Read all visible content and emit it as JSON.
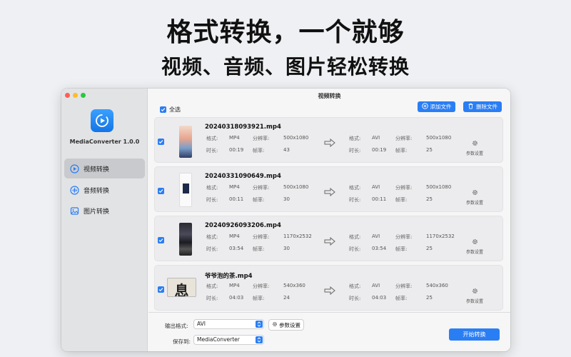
{
  "headline": {
    "line1": "格式转换，一个就够",
    "line2": "视频、音频、图片轻松转换"
  },
  "sidebar": {
    "app_name": "MediaConverter 1.0.0",
    "items": [
      {
        "label": "视频转换",
        "icon": "play-circle-icon",
        "active": true
      },
      {
        "label": "音频转换",
        "icon": "audio-wave-icon",
        "active": false
      },
      {
        "label": "图片转换",
        "icon": "image-icon",
        "active": false
      }
    ]
  },
  "window": {
    "title": "视频转换"
  },
  "toolbar": {
    "select_all": "全选",
    "add_file": "添加文件",
    "delete_file": "删除文件"
  },
  "labels": {
    "format": "格式:",
    "resolution": "分辨率:",
    "duration": "时长:",
    "framerate": "帧率:",
    "settings": "参数设置"
  },
  "files": [
    {
      "name": "20240318093921.mp4",
      "src": {
        "format": "MP4",
        "resolution": "500x1080",
        "duration": "00:19",
        "framerate": "43"
      },
      "dst": {
        "format": "AVI",
        "resolution": "500x1080",
        "duration": "00:19",
        "framerate": "25"
      },
      "checked": true
    },
    {
      "name": "20240331090649.mp4",
      "src": {
        "format": "MP4",
        "resolution": "500x1080",
        "duration": "00:11",
        "framerate": "30"
      },
      "dst": {
        "format": "AVI",
        "resolution": "500x1080",
        "duration": "00:11",
        "framerate": "25"
      },
      "checked": true
    },
    {
      "name": "20240926093206.mp4",
      "src": {
        "format": "MP4",
        "resolution": "1170x2532",
        "duration": "03:54",
        "framerate": "30"
      },
      "dst": {
        "format": "AVI",
        "resolution": "1170x2532",
        "duration": "03:54",
        "framerate": "25"
      },
      "checked": true
    },
    {
      "name": "爷爷泡的茶.mp4",
      "src": {
        "format": "MP4",
        "resolution": "540x360",
        "duration": "04:03",
        "framerate": "24"
      },
      "dst": {
        "format": "AVI",
        "resolution": "540x360",
        "duration": "04:03",
        "framerate": "25"
      },
      "checked": true
    }
  ],
  "thumb4_text": "息",
  "footer": {
    "output_format_label": "输出格式:",
    "output_format_value": "AVI",
    "params_button": "参数设置",
    "save_to_label": "保存到:",
    "save_to_value": "MediaConverter",
    "start_button": "开始转换"
  },
  "colors": {
    "accent": "#2a7ef4",
    "sidebar": "#e2e3e5",
    "row_bg": "#ececee"
  }
}
